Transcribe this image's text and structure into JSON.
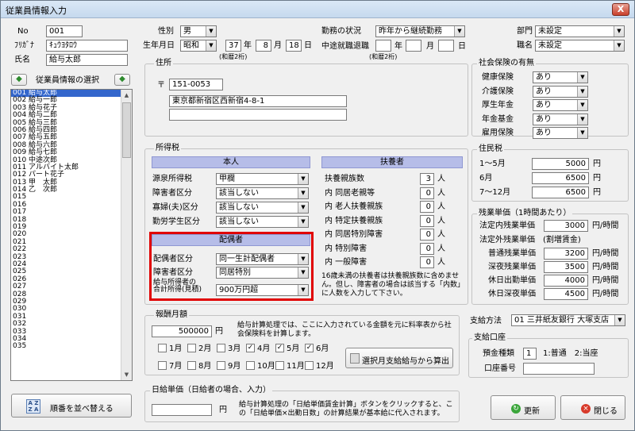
{
  "window": {
    "title": "従業員情報入力",
    "close": "X"
  },
  "emp": {
    "no_label": "No",
    "no": "001",
    "kana_label": "ﾌﾘｶﾞﾅ",
    "kana": "ｷｭｳﾖﾀﾛｳ",
    "name_label": "氏名",
    "name": "給与太郎"
  },
  "list": {
    "title": "従業員情報の選択",
    "prev_icon": "left-arrow",
    "next_icon": "right-arrow",
    "items": [
      "001 給与太郎",
      "002 給与一郎",
      "003 給与花子",
      "004 給与二郎",
      "005 給与三郎",
      "006 給与四郎",
      "007 給与五郎",
      "008 給与六郎",
      "009 給与七郎",
      "010 中途次郎",
      "011 アルバイト太郎",
      "012 パート花子",
      "013 甲　太郎",
      "014 乙　次郎",
      "015",
      "016",
      "017",
      "018",
      "019",
      "020",
      "021",
      "022",
      "023",
      "024",
      "025",
      "026",
      "027",
      "028",
      "029",
      "030",
      "031",
      "032",
      "033",
      "034",
      "035"
    ],
    "sort_button": "順番を並べ替える",
    "sort_icon": "AZ"
  },
  "personal": {
    "gender_label": "性別",
    "gender": "男",
    "birth_label": "生年月日",
    "era": "昭和",
    "year": "37",
    "year_unit": "年",
    "month": "8",
    "month_unit": "月",
    "day": "18",
    "day_unit": "日",
    "birth_note": "(和暦2桁)",
    "status_label": "勤務の状況",
    "status": "昨年から継続勤務",
    "midjoin_label": "中途就職退職",
    "mj_year": "",
    "mj_year_unit": "年",
    "mj_month": "",
    "mj_month_unit": "月",
    "mj_day": "",
    "mj_day_unit": "日",
    "mj_note": "(和暦2桁)",
    "dept_label": "部門",
    "dept": "未設定",
    "title_label": "職名",
    "title": "未設定"
  },
  "address": {
    "label": "住所",
    "zip_mark": "〒",
    "zip": "151-0053",
    "line1": "東京都新宿区西新宿4-8-1",
    "line2": ""
  },
  "insurance": {
    "label": "社会保険の有無",
    "rows": [
      {
        "label": "健康保険",
        "value": "あり"
      },
      {
        "label": "介護保険",
        "value": "あり"
      },
      {
        "label": "厚生年金",
        "value": "あり"
      },
      {
        "label": "年金基金",
        "value": "あり"
      },
      {
        "label": "雇用保険",
        "value": "あり"
      }
    ]
  },
  "incometax": {
    "label": "所得税",
    "self_header": "本人",
    "rows": [
      {
        "label": "源泉所得税",
        "value": "甲欄"
      },
      {
        "label": "障害者区分",
        "value": "該当しない"
      },
      {
        "label": "寡婦(夫)区分",
        "value": "該当しない"
      },
      {
        "label": "勤労学生区分",
        "value": "該当しない"
      }
    ],
    "spouse_header": "配偶者",
    "spouse_rows": [
      {
        "label": "配偶者区分",
        "value": "同一生計配偶者"
      },
      {
        "label": "障害者区分",
        "value": "同居特別"
      }
    ],
    "spouse_income_label1": "給与所得者の",
    "spouse_income_label2": "合計所得(見積)",
    "spouse_income": "900万円超",
    "dep_header": "扶養者",
    "dep_rows": [
      {
        "label": "扶養親族数",
        "value": "3",
        "unit": "人"
      },
      {
        "label": "内 同居老親等",
        "value": "0",
        "unit": "人"
      },
      {
        "label": "内 老人扶養親族",
        "value": "0",
        "unit": "人"
      },
      {
        "label": "内 特定扶養親族",
        "value": "0",
        "unit": "人"
      },
      {
        "label": "内 同居特別障害",
        "value": "0",
        "unit": "人"
      },
      {
        "label": "内 特別障害",
        "value": "0",
        "unit": "人"
      },
      {
        "label": "内 一般障害",
        "value": "0",
        "unit": "人"
      }
    ],
    "dep_note": "16歳未満の扶養者は扶養親族数に含めません。但し、障害者の場合は該当する「内数」に人数を入力して下さい。"
  },
  "residence": {
    "label": "住民税",
    "rows": [
      {
        "label": "1〜5月",
        "value": "5000",
        "unit": "円"
      },
      {
        "label": "6月",
        "value": "6500",
        "unit": "円"
      },
      {
        "label": "7〜12月",
        "value": "6500",
        "unit": "円"
      }
    ]
  },
  "overtime": {
    "label": "残業単価（1時間あたり）",
    "rows": [
      {
        "label": "法定内残業単価",
        "value": "3000",
        "unit": "円/時間"
      },
      {
        "label": "法定外残業単価　(割増賃金)",
        "value": "",
        "unit": ""
      },
      {
        "label": "普通残業単価",
        "value": "3200",
        "unit": "円/時間"
      },
      {
        "label": "深夜残業単価",
        "value": "3500",
        "unit": "円/時間"
      },
      {
        "label": "休日出勤単価",
        "value": "4000",
        "unit": "円/時間"
      },
      {
        "label": "休日深夜単価",
        "value": "4500",
        "unit": "円/時間"
      }
    ]
  },
  "salary": {
    "label": "報酬月額",
    "amount": "500000",
    "unit": "円",
    "note": "給与計算処理では、ここに入力されている金額を元に料率表から社会保険料を計算します。",
    "months": [
      {
        "label": "1月",
        "checked": false
      },
      {
        "label": "2月",
        "checked": false
      },
      {
        "label": "3月",
        "checked": false
      },
      {
        "label": "4月",
        "checked": true
      },
      {
        "label": "5月",
        "checked": true
      },
      {
        "label": "6月",
        "checked": true
      },
      {
        "label": "7月",
        "checked": false
      },
      {
        "label": "8月",
        "checked": false
      },
      {
        "label": "9月",
        "checked": false
      },
      {
        "label": "10月",
        "checked": false
      },
      {
        "label": "11月",
        "checked": false
      },
      {
        "label": "12月",
        "checked": false
      }
    ],
    "calc_button": "選択月支給給与から算出"
  },
  "daily": {
    "label": "日給単価（日給者の場合、入力）",
    "amount": "",
    "unit": "円",
    "note": "給与計算処理の「日給単価賃金計算」ボタンをクリックすると、この「日給単価×出勤日数」の計算結果が基本給に代入されます。"
  },
  "payment": {
    "label": "支給方法",
    "method": "01 三井紙友銀行 大塚支店",
    "account_label": "支給口座",
    "type_label": "預金種類",
    "type_value": "1",
    "type_hint": "1:普通　2:当座",
    "number_label": "口座番号",
    "number": ""
  },
  "buttons": {
    "update": "更新",
    "close": "閉じる"
  }
}
